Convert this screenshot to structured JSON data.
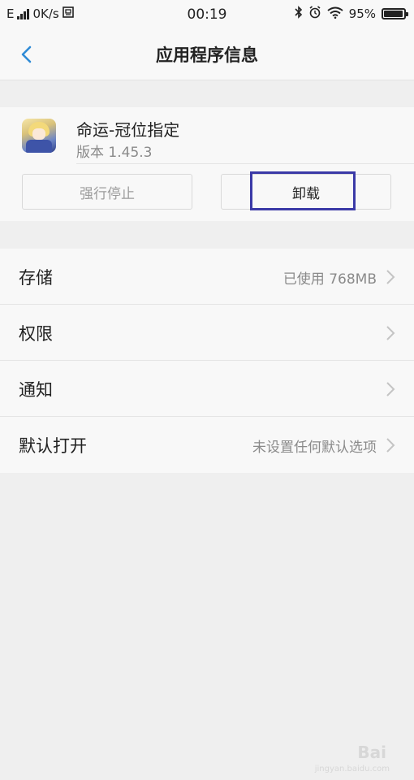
{
  "status_bar": {
    "network": "E",
    "speed": "0K/s",
    "time": "00:19",
    "battery_percent": "95%",
    "battery_level": 0.95
  },
  "header": {
    "title": "应用程序信息"
  },
  "app": {
    "name": "命运-冠位指定",
    "version": "版本 1.45.3",
    "force_stop_label": "强行停止",
    "uninstall_label": "卸载"
  },
  "settings": {
    "items": [
      {
        "label": "存储",
        "value": "已使用 768MB"
      },
      {
        "label": "权限",
        "value": ""
      },
      {
        "label": "通知",
        "value": ""
      },
      {
        "label": "默认打开",
        "value": "未设置任何默认选项"
      }
    ]
  },
  "watermark": {
    "brand": "Bai",
    "sub": "jingyan.baidu.com"
  },
  "colors": {
    "accent": "#2f8bd6",
    "highlight_frame": "#3b3aa7",
    "background": "#efefef",
    "surface": "#f8f8f8"
  }
}
